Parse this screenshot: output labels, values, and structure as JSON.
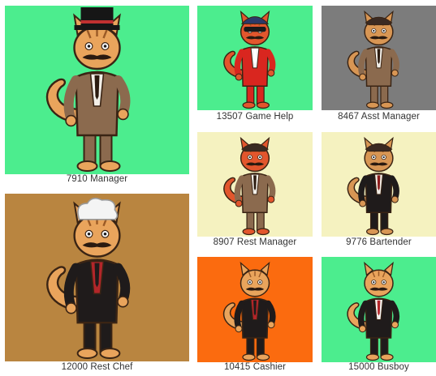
{
  "gallery": {
    "items": [
      {
        "id": "manager",
        "label": "7910 Manager",
        "bg": "#4ced8e",
        "character": "cat-manager-top-hat",
        "hat": "top-hat",
        "outfit": "brown-suit",
        "fur": "#e9a45c"
      },
      {
        "id": "game-help",
        "label": "13507 Game Help",
        "bg": "#4ced8e",
        "character": "cat-game-help-racer",
        "hat": "racing-cap",
        "outfit": "red-racing-suit",
        "fur": "#e2562d"
      },
      {
        "id": "asst-manager",
        "label": "8467 Asst Manager",
        "bg": "#7c7c7c",
        "character": "cat-asst-manager",
        "hat": "flat-cap",
        "outfit": "brown-suit",
        "fur": "#d89654"
      },
      {
        "id": "rest-manager",
        "label": "8907 Rest Manager",
        "bg": "#f5f2c0",
        "character": "cat-rest-manager",
        "hat": "flat-cap",
        "outfit": "brown-suit",
        "fur": "#e2562d"
      },
      {
        "id": "bartender",
        "label": "9776 Bartender",
        "bg": "#f5f2c0",
        "character": "cat-bartender",
        "hat": "flat-cap",
        "outfit": "black-vest",
        "fur": "#d89654"
      },
      {
        "id": "rest-chef",
        "label": "12000 Rest Chef",
        "bg": "#b98540",
        "character": "cat-rest-chef",
        "hat": "chef-hat",
        "outfit": "black-vest-red-shirt",
        "fur": "#e9a45c"
      },
      {
        "id": "cashier",
        "label": "10415 Cashier",
        "bg": "#fb6b0f",
        "character": "cat-cashier",
        "hat": "none",
        "outfit": "black-vest-red-shirt",
        "fur": "#e9a45c"
      },
      {
        "id": "busboy",
        "label": "15000 Busboy",
        "bg": "#4ced8e",
        "character": "cat-busboy",
        "hat": "none",
        "outfit": "black-vest-white-shirt",
        "fur": "#e9a45c"
      }
    ]
  }
}
